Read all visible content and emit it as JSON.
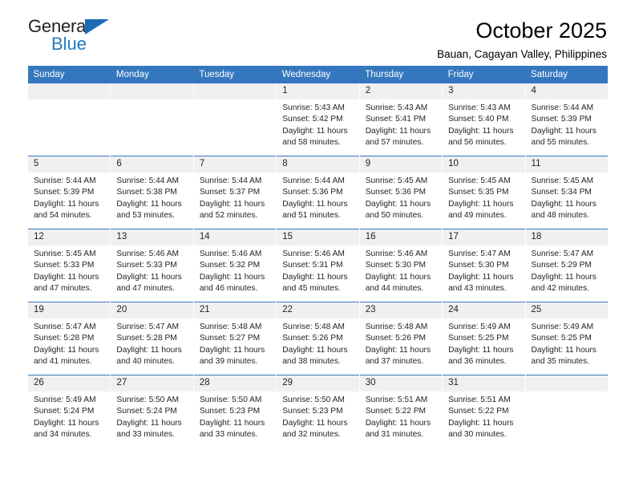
{
  "brand": {
    "name_top": "General",
    "name_bottom": "Blue",
    "triangle_color": "#1b6cb5",
    "accent_color": "#3477BE"
  },
  "header": {
    "title": "October 2025",
    "subtitle": "Bauan, Cagayan Valley, Philippines"
  },
  "calendar": {
    "weekday_headers": [
      "Sunday",
      "Monday",
      "Tuesday",
      "Wednesday",
      "Thursday",
      "Friday",
      "Saturday"
    ],
    "labels": {
      "sunrise_prefix": "Sunrise:",
      "sunset_prefix": "Sunset:",
      "daylight_prefix": "Daylight:"
    },
    "weeks": [
      [
        {
          "day": "",
          "empty": true
        },
        {
          "day": "",
          "empty": true
        },
        {
          "day": "",
          "empty": true
        },
        {
          "day": "1",
          "sunrise": "Sunrise: 5:43 AM",
          "sunset": "Sunset: 5:42 PM",
          "daylight": "Daylight: 11 hours and 58 minutes."
        },
        {
          "day": "2",
          "sunrise": "Sunrise: 5:43 AM",
          "sunset": "Sunset: 5:41 PM",
          "daylight": "Daylight: 11 hours and 57 minutes."
        },
        {
          "day": "3",
          "sunrise": "Sunrise: 5:43 AM",
          "sunset": "Sunset: 5:40 PM",
          "daylight": "Daylight: 11 hours and 56 minutes."
        },
        {
          "day": "4",
          "sunrise": "Sunrise: 5:44 AM",
          "sunset": "Sunset: 5:39 PM",
          "daylight": "Daylight: 11 hours and 55 minutes."
        }
      ],
      [
        {
          "day": "5",
          "sunrise": "Sunrise: 5:44 AM",
          "sunset": "Sunset: 5:39 PM",
          "daylight": "Daylight: 11 hours and 54 minutes."
        },
        {
          "day": "6",
          "sunrise": "Sunrise: 5:44 AM",
          "sunset": "Sunset: 5:38 PM",
          "daylight": "Daylight: 11 hours and 53 minutes."
        },
        {
          "day": "7",
          "sunrise": "Sunrise: 5:44 AM",
          "sunset": "Sunset: 5:37 PM",
          "daylight": "Daylight: 11 hours and 52 minutes."
        },
        {
          "day": "8",
          "sunrise": "Sunrise: 5:44 AM",
          "sunset": "Sunset: 5:36 PM",
          "daylight": "Daylight: 11 hours and 51 minutes."
        },
        {
          "day": "9",
          "sunrise": "Sunrise: 5:45 AM",
          "sunset": "Sunset: 5:36 PM",
          "daylight": "Daylight: 11 hours and 50 minutes."
        },
        {
          "day": "10",
          "sunrise": "Sunrise: 5:45 AM",
          "sunset": "Sunset: 5:35 PM",
          "daylight": "Daylight: 11 hours and 49 minutes."
        },
        {
          "day": "11",
          "sunrise": "Sunrise: 5:45 AM",
          "sunset": "Sunset: 5:34 PM",
          "daylight": "Daylight: 11 hours and 48 minutes."
        }
      ],
      [
        {
          "day": "12",
          "sunrise": "Sunrise: 5:45 AM",
          "sunset": "Sunset: 5:33 PM",
          "daylight": "Daylight: 11 hours and 47 minutes."
        },
        {
          "day": "13",
          "sunrise": "Sunrise: 5:46 AM",
          "sunset": "Sunset: 5:33 PM",
          "daylight": "Daylight: 11 hours and 47 minutes."
        },
        {
          "day": "14",
          "sunrise": "Sunrise: 5:46 AM",
          "sunset": "Sunset: 5:32 PM",
          "daylight": "Daylight: 11 hours and 46 minutes."
        },
        {
          "day": "15",
          "sunrise": "Sunrise: 5:46 AM",
          "sunset": "Sunset: 5:31 PM",
          "daylight": "Daylight: 11 hours and 45 minutes."
        },
        {
          "day": "16",
          "sunrise": "Sunrise: 5:46 AM",
          "sunset": "Sunset: 5:30 PM",
          "daylight": "Daylight: 11 hours and 44 minutes."
        },
        {
          "day": "17",
          "sunrise": "Sunrise: 5:47 AM",
          "sunset": "Sunset: 5:30 PM",
          "daylight": "Daylight: 11 hours and 43 minutes."
        },
        {
          "day": "18",
          "sunrise": "Sunrise: 5:47 AM",
          "sunset": "Sunset: 5:29 PM",
          "daylight": "Daylight: 11 hours and 42 minutes."
        }
      ],
      [
        {
          "day": "19",
          "sunrise": "Sunrise: 5:47 AM",
          "sunset": "Sunset: 5:28 PM",
          "daylight": "Daylight: 11 hours and 41 minutes."
        },
        {
          "day": "20",
          "sunrise": "Sunrise: 5:47 AM",
          "sunset": "Sunset: 5:28 PM",
          "daylight": "Daylight: 11 hours and 40 minutes."
        },
        {
          "day": "21",
          "sunrise": "Sunrise: 5:48 AM",
          "sunset": "Sunset: 5:27 PM",
          "daylight": "Daylight: 11 hours and 39 minutes."
        },
        {
          "day": "22",
          "sunrise": "Sunrise: 5:48 AM",
          "sunset": "Sunset: 5:26 PM",
          "daylight": "Daylight: 11 hours and 38 minutes."
        },
        {
          "day": "23",
          "sunrise": "Sunrise: 5:48 AM",
          "sunset": "Sunset: 5:26 PM",
          "daylight": "Daylight: 11 hours and 37 minutes."
        },
        {
          "day": "24",
          "sunrise": "Sunrise: 5:49 AM",
          "sunset": "Sunset: 5:25 PM",
          "daylight": "Daylight: 11 hours and 36 minutes."
        },
        {
          "day": "25",
          "sunrise": "Sunrise: 5:49 AM",
          "sunset": "Sunset: 5:25 PM",
          "daylight": "Daylight: 11 hours and 35 minutes."
        }
      ],
      [
        {
          "day": "26",
          "sunrise": "Sunrise: 5:49 AM",
          "sunset": "Sunset: 5:24 PM",
          "daylight": "Daylight: 11 hours and 34 minutes."
        },
        {
          "day": "27",
          "sunrise": "Sunrise: 5:50 AM",
          "sunset": "Sunset: 5:24 PM",
          "daylight": "Daylight: 11 hours and 33 minutes."
        },
        {
          "day": "28",
          "sunrise": "Sunrise: 5:50 AM",
          "sunset": "Sunset: 5:23 PM",
          "daylight": "Daylight: 11 hours and 33 minutes."
        },
        {
          "day": "29",
          "sunrise": "Sunrise: 5:50 AM",
          "sunset": "Sunset: 5:23 PM",
          "daylight": "Daylight: 11 hours and 32 minutes."
        },
        {
          "day": "30",
          "sunrise": "Sunrise: 5:51 AM",
          "sunset": "Sunset: 5:22 PM",
          "daylight": "Daylight: 11 hours and 31 minutes."
        },
        {
          "day": "31",
          "sunrise": "Sunrise: 5:51 AM",
          "sunset": "Sunset: 5:22 PM",
          "daylight": "Daylight: 11 hours and 30 minutes."
        },
        {
          "day": "",
          "empty": true
        }
      ]
    ]
  }
}
